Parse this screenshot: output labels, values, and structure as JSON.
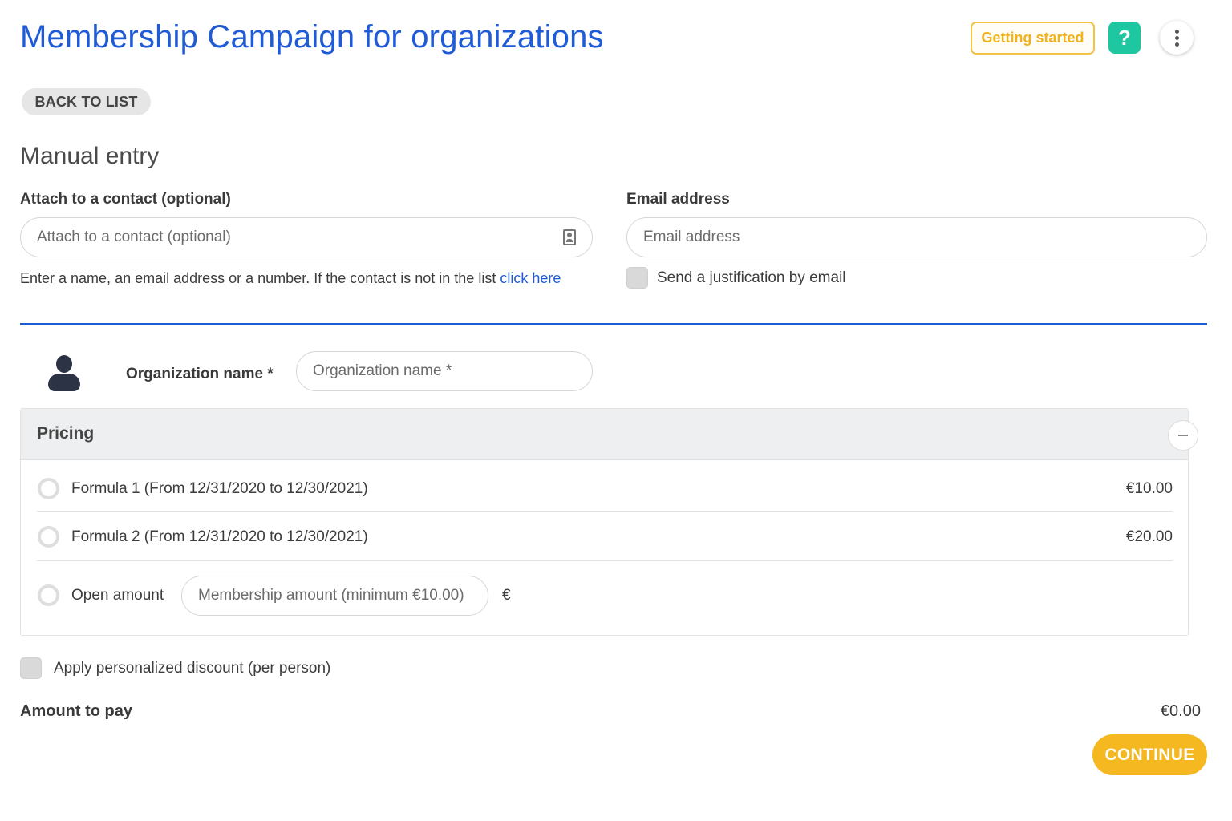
{
  "header": {
    "title": "Membership Campaign for organizations",
    "getting_started_label": "Getting started",
    "help_label": "?"
  },
  "nav": {
    "back_label": "BACK TO LIST"
  },
  "section": {
    "title": "Manual entry"
  },
  "contact": {
    "label": "Attach to a contact (optional)",
    "placeholder": "Attach to a contact (optional)",
    "helper_text": "Enter a name, an email address or a number. If the contact is not in the list ",
    "helper_link": "click here"
  },
  "email": {
    "label": "Email address",
    "placeholder": "Email address",
    "justification_label": "Send a justification by email"
  },
  "organization": {
    "label": "Organization name *",
    "placeholder": "Organization name *"
  },
  "pricing": {
    "title": "Pricing",
    "options": [
      {
        "label": "Formula 1 (From 12/31/2020 to 12/30/2021)",
        "price": "€10.00"
      },
      {
        "label": "Formula 2 (From 12/31/2020 to 12/30/2021)",
        "price": "€20.00"
      }
    ],
    "open_amount_label": "Open amount",
    "open_amount_placeholder": "Membership amount (minimum €10.00)",
    "currency_symbol": "€"
  },
  "discount": {
    "label": "Apply personalized discount (per person)"
  },
  "total": {
    "label": "Amount to pay",
    "value": "€0.00"
  },
  "actions": {
    "continue_label": "CONTINUE"
  },
  "colors": {
    "primary_blue": "#1f5bd6",
    "accent_yellow": "#f5b820",
    "help_green": "#1fc7a1"
  }
}
